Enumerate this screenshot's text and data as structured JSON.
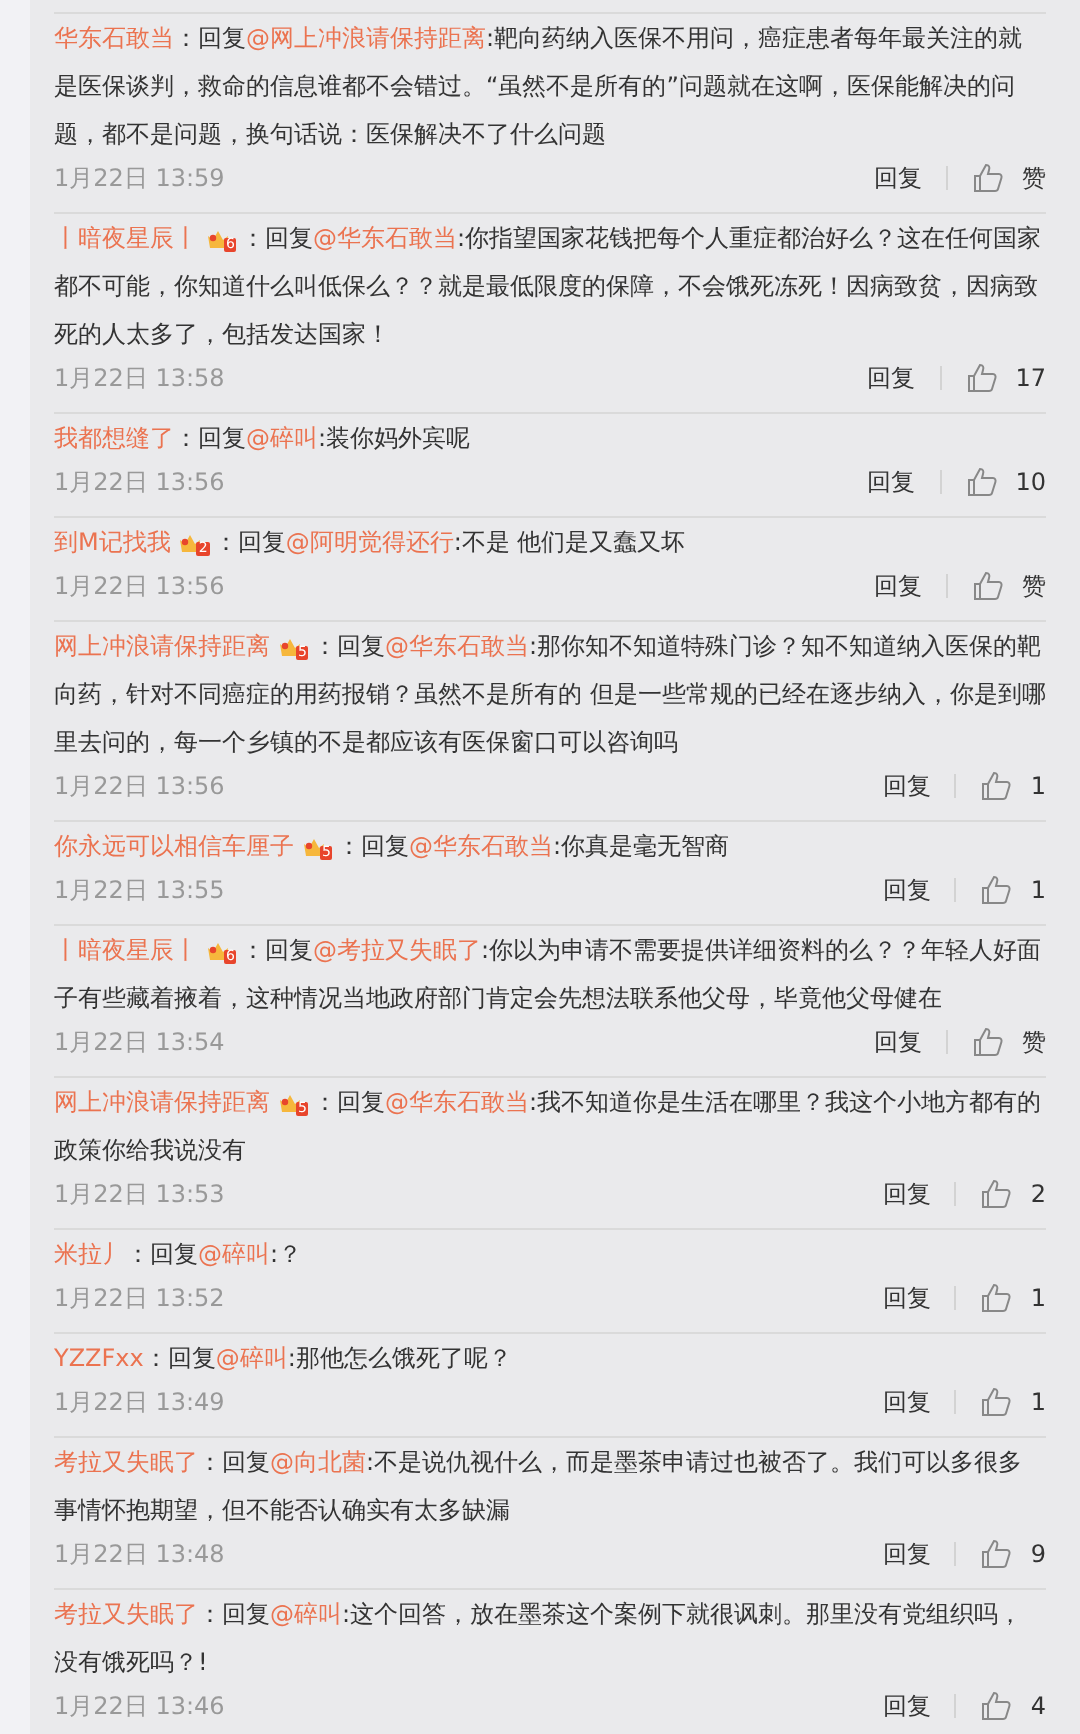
{
  "comments": [
    {
      "author": "华东石敢当",
      "prefix": "：回复",
      "mention": "@网上冲浪请保持距离",
      "text": ":靶向药纳入医保不用问，癌症患者每年最关注的就是医保谈判，救命的信息谁都不会错过。“虽然不是所有的”问题就在这啊，医保能解决的问题，都不是问题，换句话说：医保解决不了什么问题",
      "time": "1月22日 13:59",
      "reply": "回复",
      "likes": "赞"
    },
    {
      "author": "丨暗夜星辰丨",
      "badge": "6",
      "prefix": "：回复",
      "mention": "@华东石敢当",
      "text": ":你指望国家花钱把每个人重症都治好么？这在任何国家都不可能，你知道什么叫低保么？？就是最低限度的保障，不会饿死冻死！因病致贫，因病致死的人太多了，包括发达国家！",
      "time": "1月22日 13:58",
      "reply": "回复",
      "likes": "17"
    },
    {
      "author": "我都想缝了",
      "prefix": "：回复",
      "mention": "@碎叫",
      "text": ":装你妈外宾呢",
      "time": "1月22日 13:56",
      "reply": "回复",
      "likes": "10"
    },
    {
      "author": "到M记找我",
      "badge": "2",
      "prefix": "：回复",
      "mention": "@阿明觉得还行",
      "text": ":不是 他们是又蠢又坏",
      "time": "1月22日 13:56",
      "reply": "回复",
      "likes": "赞"
    },
    {
      "author": "网上冲浪请保持距离",
      "badge": "5",
      "prefix": "：回复",
      "mention": "@华东石敢当",
      "text": ":那你知不知道特殊门诊？知不知道纳入医保的靶向药，针对不同癌症的用药报销？虽然不是所有的 但是一些常规的已经在逐步纳入，你是到哪里去问的，每一个乡镇的不是都应该有医保窗口可以咨询吗",
      "time": "1月22日 13:56",
      "reply": "回复",
      "likes": "1"
    },
    {
      "author": "你永远可以相信车厘子",
      "badge": "5",
      "prefix": "：回复",
      "mention": "@华东石敢当",
      "text": ":你真是毫无智商",
      "time": "1月22日 13:55",
      "reply": "回复",
      "likes": "1"
    },
    {
      "author": "丨暗夜星辰丨",
      "badge": "6",
      "prefix": "：回复",
      "mention": "@考拉又失眠了",
      "text": ":你以为申请不需要提供详细资料的么？？年轻人好面子有些藏着掖着，这种情况当地政府部门肯定会先想法联系他父母，毕竟他父母健在",
      "time": "1月22日 13:54",
      "reply": "回复",
      "likes": "赞"
    },
    {
      "author": "网上冲浪请保持距离",
      "badge": "5",
      "prefix": "：回复",
      "mention": "@华东石敢当",
      "text": ":我不知道你是生活在哪里？我这个小地方都有的政策你给我说没有",
      "time": "1月22日 13:53",
      "reply": "回复",
      "likes": "2"
    },
    {
      "author": "米拉丿",
      "prefix": "：回复",
      "mention": "@碎叫",
      "text": ":？",
      "time": "1月22日 13:52",
      "reply": "回复",
      "likes": "1"
    },
    {
      "author": "YZZFxx",
      "prefix": "：回复",
      "mention": "@碎叫",
      "text": ":那他怎么饿死了呢？",
      "time": "1月22日 13:49",
      "reply": "回复",
      "likes": "1"
    },
    {
      "author": "考拉又失眠了",
      "prefix": "：回复",
      "mention": "@向北菌",
      "text": ":不是说仇视什么，而是墨茶申请过也被否了。我们可以多很多事情怀抱期望，但不能否认确实有太多缺漏",
      "time": "1月22日 13:48",
      "reply": "回复",
      "likes": "9"
    },
    {
      "author": "考拉又失眠了",
      "prefix": "：回复",
      "mention": "@碎叫",
      "text": ":这个回答，放在墨茶这个案例下就很讽刺。那里没有党组织吗，没有饿死吗？!",
      "time": "1月22日 13:46",
      "reply": "回复",
      "likes": "4"
    }
  ]
}
